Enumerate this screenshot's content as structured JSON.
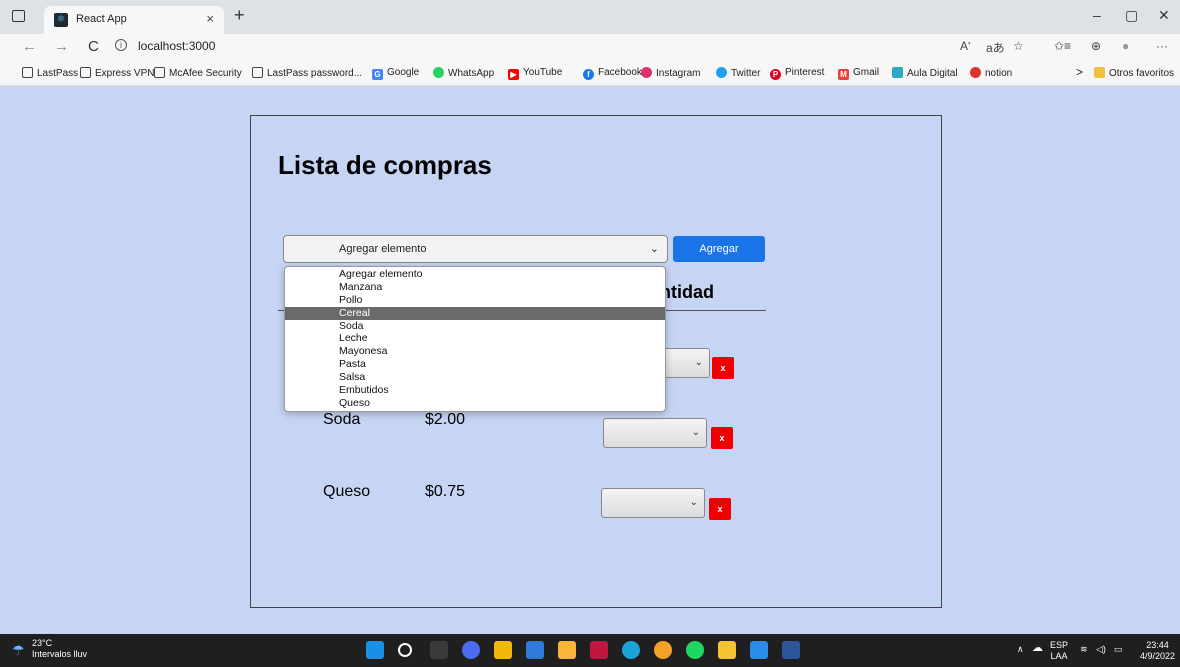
{
  "browser": {
    "tab_title": "React App",
    "tab_close": "×",
    "new_tab": "+",
    "url": "localhost:3000",
    "info_icon": "i",
    "window_controls": [
      "–",
      "▢",
      "✕"
    ],
    "nav": {
      "back": "←",
      "forward": "→",
      "reload": "C"
    },
    "toolbar_icons": [
      "Aʹ",
      "aあ",
      "☆",
      "✩≡",
      "⊕",
      "●",
      "···"
    ],
    "bookmarks": [
      {
        "label": "LastPass",
        "color": "#ffffff"
      },
      {
        "label": "Express VPN",
        "color": "#ffffff"
      },
      {
        "label": "McAfee Security",
        "color": "#ffffff"
      },
      {
        "label": "LastPass password...",
        "color": "#ffffff"
      },
      {
        "label": "Google",
        "color": "#4285f4"
      },
      {
        "label": "WhatsApp",
        "color": "#25d366"
      },
      {
        "label": "YouTube",
        "color": "#ff0000"
      },
      {
        "label": "Facebook",
        "color": "#1877f2"
      },
      {
        "label": "Instagram",
        "color": "#e1306c"
      },
      {
        "label": "Twitter",
        "color": "#1da1f2"
      },
      {
        "label": "Pinterest",
        "color": "#e60023"
      },
      {
        "label": "Gmail",
        "color": "#ea4335"
      },
      {
        "label": "Aula Digital",
        "color": "#2aa9c8"
      },
      {
        "label": "notion",
        "color": "#e03030"
      }
    ],
    "bookmarks_more": ">",
    "other_favorites": "Otros favoritos"
  },
  "page": {
    "title": "Lista de compras",
    "select_value": "Agregar elemento",
    "add_button": "Agregar",
    "column_header": "ntidad",
    "dropdown_options": [
      "Agregar elemento",
      "Manzana",
      "Pollo",
      "Cereal",
      "Soda",
      "Leche",
      "Mayonesa",
      "Pasta",
      "Salsa",
      "Embutidos",
      "Queso"
    ],
    "selected_option": "Cereal",
    "chevron": "⌄",
    "delete_label": "x",
    "rows": [
      {
        "name": "",
        "price": ""
      },
      {
        "name": "Soda",
        "price": "$2.00"
      },
      {
        "name": "Queso",
        "price": "$0.75"
      }
    ]
  },
  "taskbar": {
    "weather_temp": "23°C",
    "weather_desc": "Intervalos lluv",
    "lang": "ESP",
    "lang_sub": "LAA",
    "time": "23:44",
    "date": "4/9/2022",
    "caret": "∧",
    "app_colors": [
      "#1a8fe3",
      "#ffffff",
      "#3a3a3a",
      "#4b6cf0",
      "#f2b90d",
      "#2f7ad9",
      "#f9b53b",
      "#c0163f",
      "#1aa3d9",
      "#f4a22a",
      "#1ed760",
      "#f4c430",
      "#2a8be8",
      "#2b579a"
    ]
  }
}
